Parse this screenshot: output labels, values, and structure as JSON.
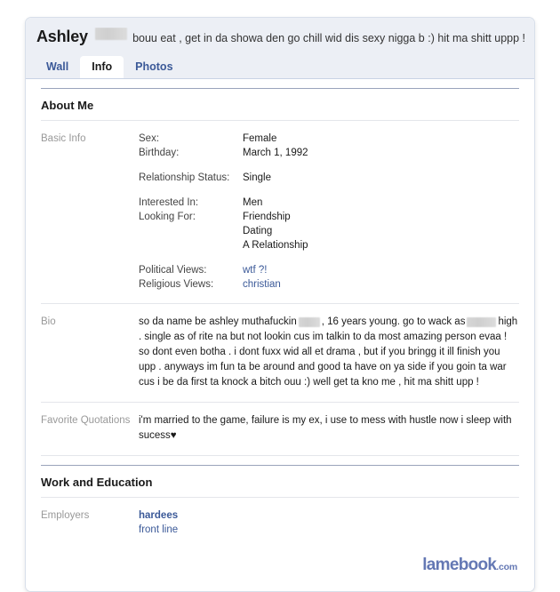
{
  "profile": {
    "name": "Ashley",
    "name_redacted": true,
    "status_text": "bouu eat , get in da showa den go chill wid dis sexy nigga b :) hit ma shitt uppp !"
  },
  "tabs": [
    {
      "label": "Wall",
      "active": false
    },
    {
      "label": "Info",
      "active": true
    },
    {
      "label": "Photos",
      "active": false
    }
  ],
  "sections": {
    "about_me": {
      "title": "About Me",
      "basic_info": {
        "label": "Basic Info",
        "groups": [
          {
            "fields": [
              {
                "label": "Sex:",
                "value": "Female",
                "is_link": false
              },
              {
                "label": "Birthday:",
                "value": "March 1, 1992",
                "is_link": false
              }
            ]
          },
          {
            "fields": [
              {
                "label": "Relationship Status:",
                "value": "Single",
                "is_link": false
              }
            ]
          },
          {
            "fields": [
              {
                "label": "Interested In:",
                "value": "Men",
                "is_link": false
              },
              {
                "label": "Looking For:",
                "value": "Friendship",
                "is_link": false
              }
            ],
            "extra_values": [
              "Dating",
              "A Relationship"
            ]
          },
          {
            "fields": [
              {
                "label": "Political Views:",
                "value": "wtf ?!",
                "is_link": true
              },
              {
                "label": "Religious Views:",
                "value": "christian",
                "is_link": true
              }
            ]
          }
        ]
      },
      "bio": {
        "label": "Bio",
        "part1": "so da name be ashley muthafuckin",
        "part2": ", 16 years young. go to wack as",
        "part3": "high . single as of rite na but not lookin cus im talkin to da most amazing person evaa ! so dont even botha . i dont fuxx wid all et drama , but if you bringg it ill finish you upp . anyways im fun ta be around and good ta have on ya side if you goin ta war cus i be da first ta knock a bitch ouu :) well get ta kno me , hit ma shitt upp !"
      },
      "favorite_quotations": {
        "label": "Favorite Quotations",
        "text": "i'm married to the game, failure is my ex, i use to mess with hustle now i sleep with sucess",
        "suffix": "♥"
      }
    },
    "work_and_education": {
      "title": "Work and Education",
      "employers": {
        "label": "Employers",
        "primary": "hardees",
        "secondary": "front line"
      }
    }
  },
  "watermark": {
    "name": "lamebook",
    "tld": ".com"
  },
  "colors": {
    "link": "#3b5998",
    "header_bg": "#eceff5",
    "label_gray": "#999999",
    "watermark": "#6478b4"
  }
}
